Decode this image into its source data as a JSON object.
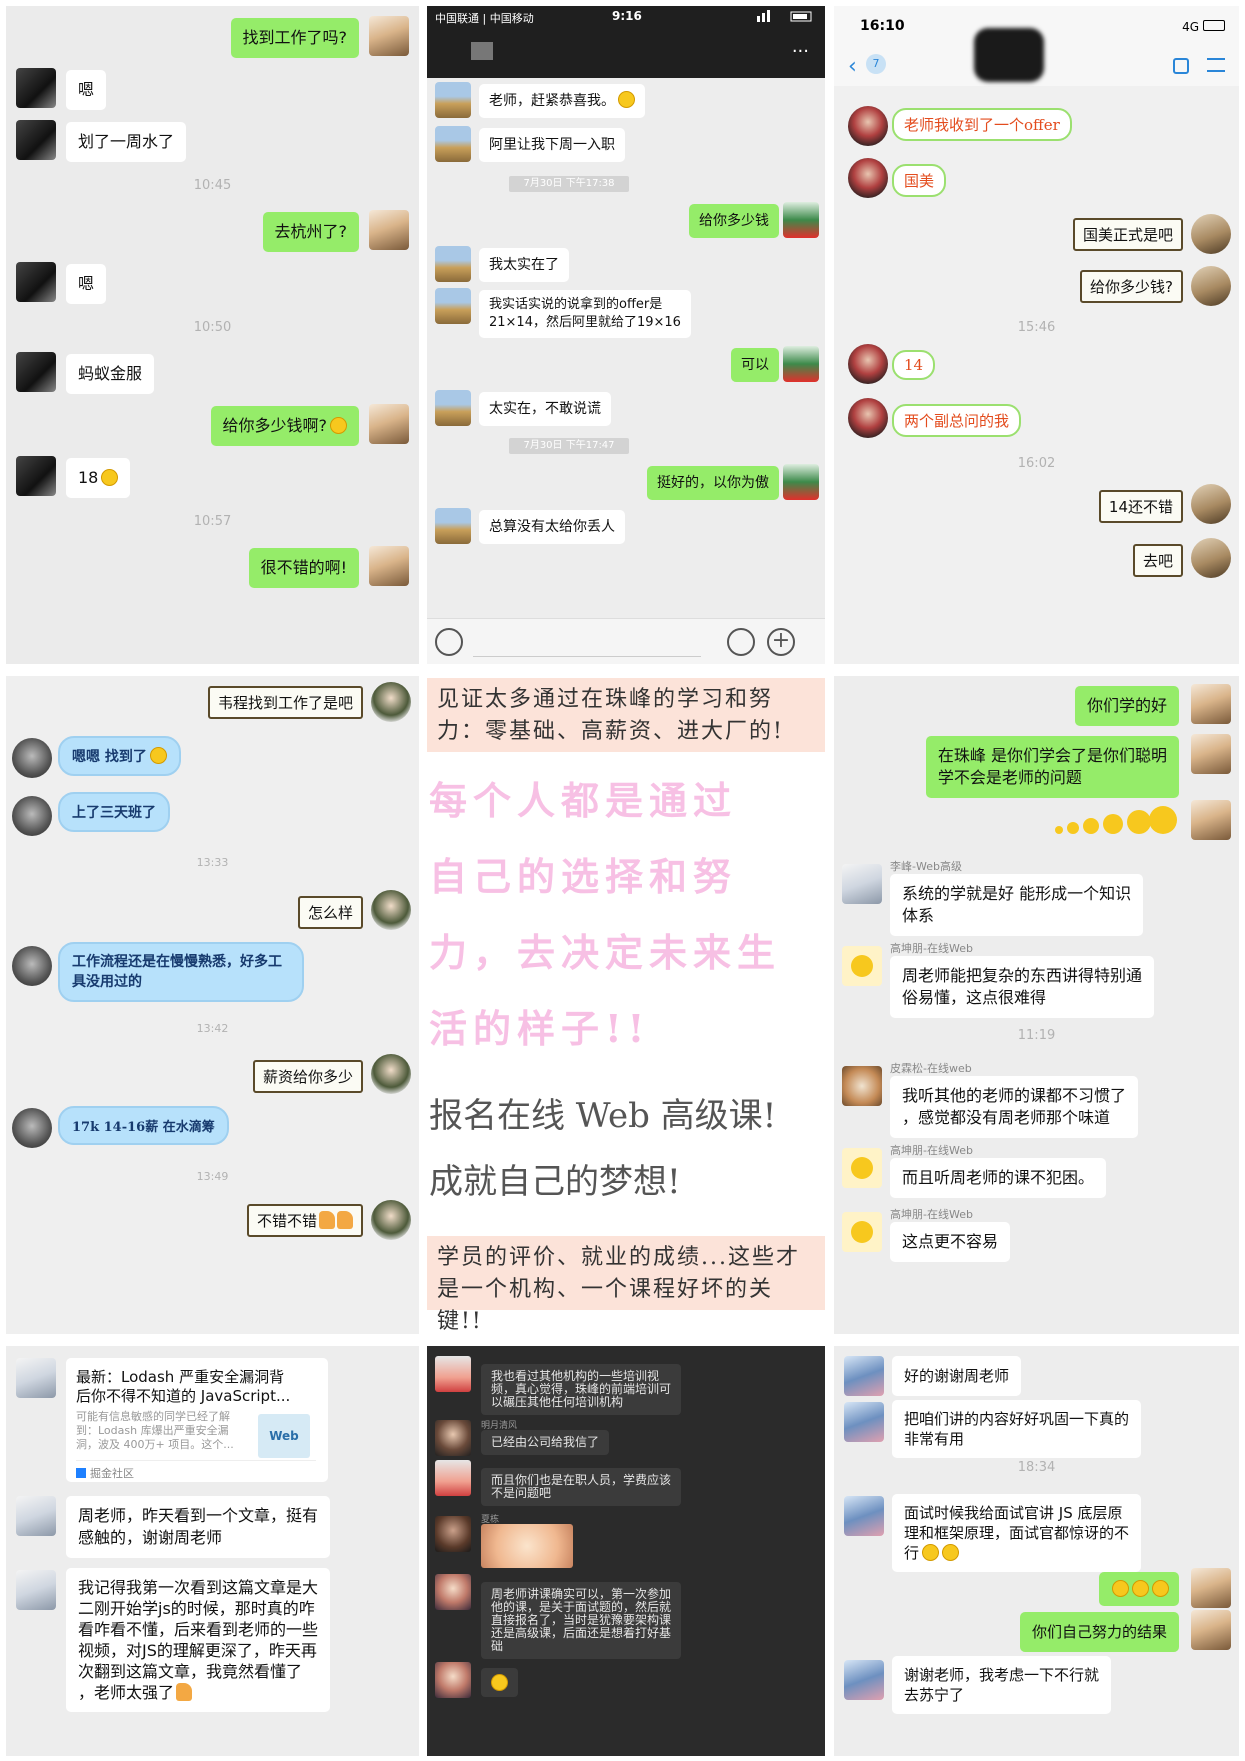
{
  "p1": {
    "messages": [
      "找到工作了吗?",
      "嗯",
      "划了一周水了",
      "去杭州了?",
      "嗯",
      "蚂蚁金服",
      "给你多少钱啊?",
      "18",
      "很不错的啊!"
    ],
    "times": [
      "10:45",
      "10:50",
      "10:57"
    ]
  },
  "p2": {
    "status": {
      "carrier": "中国联通 | 中国移动",
      "time": "9:16",
      "more": "..."
    },
    "messages": [
      "老师，赶紧恭喜我。",
      "阿里让我下周一入职",
      "给你多少钱",
      "我太实在了",
      "我实话实说的说拿到的offer是\n21×14，然后阿里就给了19×16",
      "可以",
      "太实在，不敢说谎",
      "挺好的，以你为傲",
      "总算没有太给你丢人"
    ],
    "times": [
      "7月30日 下午17:38",
      "7月30日 下午17:47"
    ]
  },
  "p3": {
    "status": {
      "time": "16:10",
      "network": "4G",
      "badge": "7"
    },
    "messages": [
      "老师我收到了一个offer",
      "国美",
      "国美正式是吧",
      "给你多少钱?",
      "14",
      "两个副总问的我",
      "14还不错",
      "去吧"
    ],
    "times": [
      "15:46",
      "16:02"
    ]
  },
  "p4": {
    "messages": [
      "韦程找到工作了是吧",
      "嗯嗯 找到了",
      "上了三天班了",
      "怎么样",
      "工作流程还是在慢慢熟悉，好多工具没用过的",
      "薪资给你多少",
      "17k  14-16薪  在水滴筹",
      "不错不错"
    ],
    "times": [
      "13:33",
      "13:42",
      "13:49"
    ]
  },
  "p5": {
    "top": "见证太多通过在珠峰的学习和努力：零基础、高薪资、进大厂的!",
    "pink": [
      "每个人都是通过",
      "自己的选择和努",
      "力，去决定未来生",
      "活的样子!!"
    ],
    "grey": [
      "报名在线 Web 高级课!",
      "成就自己的梦想!"
    ],
    "bottom": "学员的评价、就业的成绩...这些才是一个机构、一个课程好坏的关键!!"
  },
  "p6": {
    "messages": [
      "你们学的好",
      "在珠峰 是你们学会了是你们聪明\n学不会是老师的问题",
      "系统的学就是好 能形成一个知识\n体系",
      "周老师能把复杂的东西讲得特别通\n俗易懂，这点很难得",
      "我听其他的老师的课都不习惯了\n，感觉都没有周老师那个味道",
      "而且听周老师的课不犯困。",
      "这点更不容易"
    ],
    "names": [
      "李峰-Web高级",
      "高坤朋-在线Web",
      "皮霖松-在线web",
      "高坤朋-在线Web",
      "高坤朋-在线Web"
    ],
    "times": [
      "11:19"
    ]
  },
  "p7": {
    "card": {
      "title": "最新：Lodash 严重安全漏洞背\n后你不得不知道的 JavaScript...",
      "desc": "可能有信息敏感的同学已经了解\n到：Lodash 库爆出严重安全漏\n洞，波及 400万+ 项目。这个...",
      "source": "掘金社区",
      "thumb": "Web"
    },
    "messages": [
      "周老师，昨天看到一个文章，挺有\n感触的，谢谢周老师",
      "我记得我第一次看到这篇文章是大\n二刚开始学js的时候，那时真的咋\n看咋看不懂，后来看到老师的一些\n视频，对JS的理解更深了，昨天再\n次翻到这篇文章，我竟然看懂了\n，老师太强了"
    ]
  },
  "p8": {
    "messages": [
      "我也看过其他机构的一些培训视\n频，真心觉得，珠峰的前端培训可\n以碾压其他任何培训机构",
      "已经由公司给我信了",
      "而且你们也是在职人员，学费应该\n不是问题吧",
      "周老师讲课确实可以，第一次参加\n他的课，是关于面试题的，然后就\n直接报名了，当时是犹豫要架构课\n还是高级课，后面还是想着打好基\n础"
    ],
    "names": [
      "明月清风",
      "夏栋"
    ]
  },
  "p9": {
    "messages": [
      "好的谢谢周老师",
      "把咱们讲的内容好好巩固一下真的\n非常有用",
      "面试时候我给面试官讲 JS 底层原\n理和框架原理，面试官都惊讶的不\n行",
      "你们自己努力的结果",
      "谢谢老师，我考虑一下不行就\n去苏宁了"
    ],
    "times": [
      "18:34"
    ]
  },
  "colors": {
    "green_bubble": "#95ec69",
    "pink_text": "#f7c0e4",
    "peach_box": "#fce3d9"
  }
}
